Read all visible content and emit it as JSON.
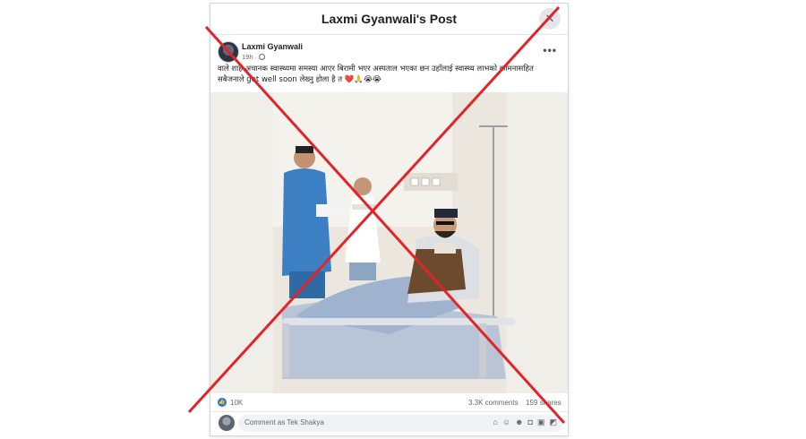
{
  "modal": {
    "title": "Laxmi Gyanwali's Post",
    "close_glyph": "✕"
  },
  "post": {
    "author": "Laxmi Gyanwali",
    "time": "19h · ",
    "more_glyph": "•••",
    "text_line1": "वाले शाह अचानक स्वास्थ्यमा समस्या आएर बिरामी भएर अस्पताल भएका छन उहाँलाई स्वास्थ्य लाभको कामनासहित",
    "text_line2": "सबैजनाले get well soon लेख्नु होला है त ❤️🙏😭😭"
  },
  "stats": {
    "likes": "10K",
    "comments": "3.3K comments",
    "shares": "159 shares"
  },
  "comment": {
    "placeholder": "Comment as Tek Shakya",
    "icons": [
      "sticker-icon",
      "avatar-sticker-icon",
      "emoji-icon",
      "camera-icon",
      "gif-icon",
      "sticker-face-icon"
    ]
  },
  "colors": {
    "facebook_blue": "#1877f2",
    "cross_red": "#e0242a"
  }
}
